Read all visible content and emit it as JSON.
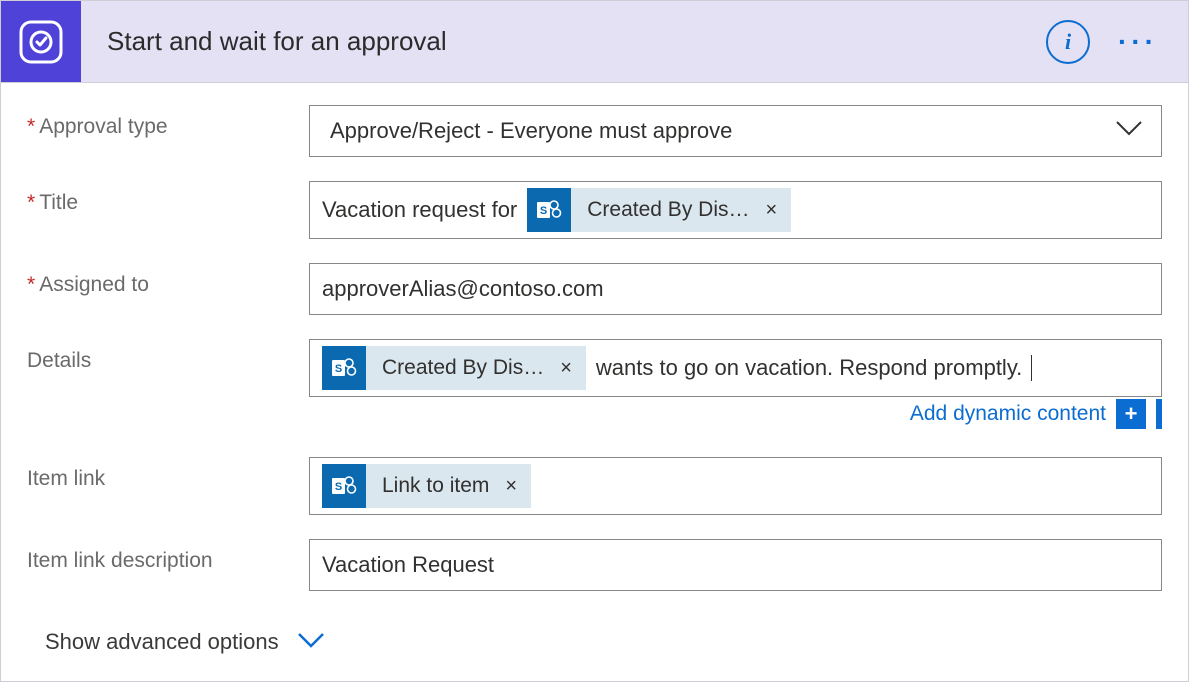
{
  "header": {
    "title": "Start and wait for an approval"
  },
  "fields": {
    "approval_type": {
      "label": "Approval type",
      "required": true,
      "value": "Approve/Reject - Everyone must approve"
    },
    "title": {
      "label": "Title",
      "required": true,
      "pre_text": "Vacation request for ",
      "token": {
        "label": "Created By Dis…",
        "source": "sharepoint"
      }
    },
    "assigned_to": {
      "label": "Assigned to",
      "required": true,
      "value": "approverAlias@contoso.com"
    },
    "details": {
      "label": "Details",
      "required": false,
      "token": {
        "label": "Created By Dis…",
        "source": "sharepoint"
      },
      "post_text": "wants to go on vacation. Respond promptly."
    },
    "item_link": {
      "label": "Item link",
      "required": false,
      "token": {
        "label": "Link to item",
        "source": "sharepoint"
      }
    },
    "item_link_desc": {
      "label": "Item link description",
      "required": false,
      "value": "Vacation Request"
    }
  },
  "actions": {
    "add_dynamic_content": "Add dynamic content",
    "show_advanced": "Show advanced options"
  },
  "glyphs": {
    "required_marker": "*",
    "times": "×",
    "plus": "+"
  }
}
